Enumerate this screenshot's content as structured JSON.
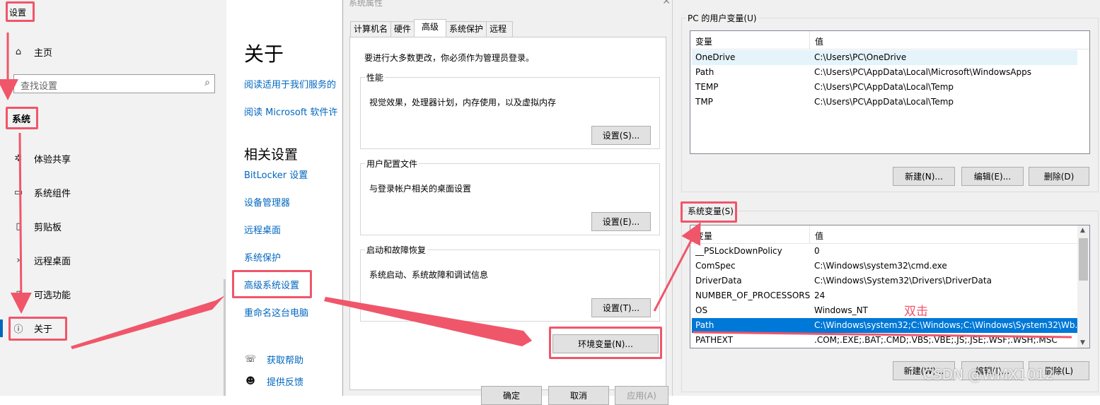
{
  "settings": {
    "title": "设置",
    "home_label": "主页",
    "search_placeholder": "查找设置",
    "section": "系统",
    "nav": [
      {
        "label": "体验共享"
      },
      {
        "label": "系统组件"
      },
      {
        "label": "剪贴板"
      },
      {
        "label": "远程桌面"
      },
      {
        "label": "可选功能"
      },
      {
        "label": "关于"
      }
    ]
  },
  "about": {
    "title": "关于",
    "links": [
      "阅读适用于我们服务的",
      "阅读 Microsoft 软件许"
    ],
    "related_title": "相关设置",
    "related": [
      "BitLocker 设置",
      "设备管理器",
      "远程桌面",
      "系统保护",
      "高级系统设置",
      "重命名这台电脑"
    ],
    "help": [
      "获取帮助",
      "提供反馈"
    ]
  },
  "system_properties": {
    "title": "系统属性",
    "tabs": [
      "计算机名",
      "硬件",
      "高级",
      "系统保护",
      "远程"
    ],
    "active_tab": "高级",
    "notice": "要进行大多数更改，你必须作为管理员登录。",
    "groups": [
      {
        "legend": "性能",
        "desc": "视觉效果，处理器计划，内存使用，以及虚拟内存",
        "button": "设置(S)..."
      },
      {
        "legend": "用户配置文件",
        "desc": "与登录帐户相关的桌面设置",
        "button": "设置(E)..."
      },
      {
        "legend": "启动和故障恢复",
        "desc": "系统启动、系统故障和调试信息",
        "button": "设置(T)..."
      }
    ],
    "env_button": "环境变量(N)...",
    "footer_buttons": [
      "确定",
      "取消",
      "应用(A)"
    ]
  },
  "env_vars": {
    "user_group": "PC 的用户变量(U)",
    "system_group": "系统变量(S)",
    "col_var": "变量",
    "col_val": "值",
    "user_rows": [
      {
        "name": "OneDrive",
        "value": "C:\\Users\\PC\\OneDrive"
      },
      {
        "name": "Path",
        "value": "C:\\Users\\PC\\AppData\\Local\\Microsoft\\WindowsApps"
      },
      {
        "name": "TEMP",
        "value": "C:\\Users\\PC\\AppData\\Local\\Temp"
      },
      {
        "name": "TMP",
        "value": "C:\\Users\\PC\\AppData\\Local\\Temp"
      }
    ],
    "system_rows": [
      {
        "name": "__PSLockDownPolicy",
        "value": "0"
      },
      {
        "name": "ComSpec",
        "value": "C:\\Windows\\system32\\cmd.exe"
      },
      {
        "name": "DriverData",
        "value": "C:\\Windows\\System32\\Drivers\\DriverData"
      },
      {
        "name": "NUMBER_OF_PROCESSORS",
        "value": "24"
      },
      {
        "name": "OS",
        "value": "Windows_NT"
      },
      {
        "name": "Path",
        "value": "C:\\Windows\\system32;C:\\Windows;C:\\Windows\\System32\\Wb..."
      },
      {
        "name": "PATHEXT",
        "value": ".COM;.EXE;.BAT;.CMD;.VBS;.VBE;.JS;.JSE;.WSF;.WSH;.MSC"
      }
    ],
    "user_buttons": [
      "新建(N)...",
      "编辑(E)...",
      "删除(D)"
    ],
    "system_buttons": [
      "新建(W)...",
      "编辑(I)...",
      "删除(L)"
    ]
  },
  "annotation": {
    "double_click": "双击",
    "color": "#f0566a"
  },
  "watermark": "CSDN @WMX1012"
}
